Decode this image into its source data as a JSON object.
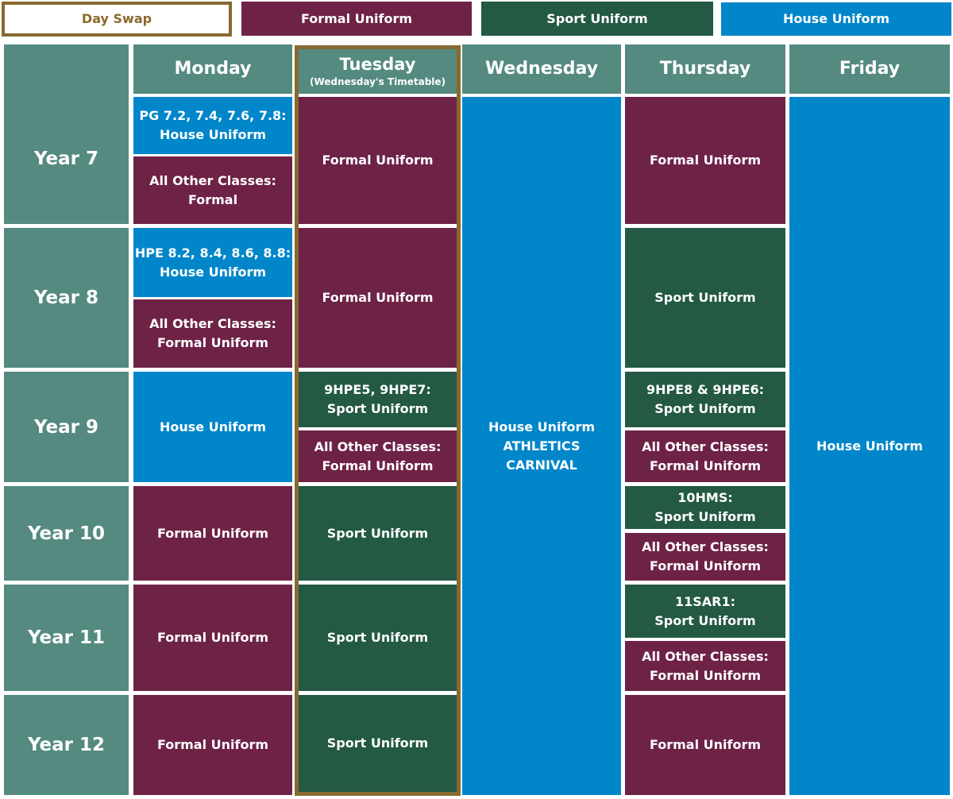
{
  "legend": {
    "day_swap": "Day Swap",
    "formal": "Formal Uniform",
    "sport": "Sport Uniform",
    "house": "House Uniform"
  },
  "colors": {
    "formal": "#6e2246",
    "sport": "#245943",
    "house": "#0186ca",
    "header": "#548a7f",
    "day_swap_border": "#866a2f"
  },
  "days": {
    "monday": "Monday",
    "tuesday": "Tuesday",
    "tuesday_note": "(Wednesday's Timetable)",
    "wednesday": "Wednesday",
    "thursday": "Thursday",
    "friday": "Friday"
  },
  "years": {
    "y7": "Year 7",
    "y8": "Year 8",
    "y9": "Year 9",
    "y10": "Year 10",
    "y11": "Year 11",
    "y12": "Year 12"
  },
  "monday": {
    "y7_a": "PG 7.2, 7.4, 7.6, 7.8:\nHouse  Uniform",
    "y7_b": "All Other Classes:\nFormal",
    "y8_a": "HPE 8.2, 8.4, 8.6, 8.8:\nHouse  Uniform",
    "y8_b": "All Other Classes:\nFormal  Uniform",
    "y9": "House Uniform",
    "y10": "Formal Uniform",
    "y11": "Formal Uniform",
    "y12": "Formal Uniform"
  },
  "tuesday": {
    "y7": "Formal Uniform",
    "y8": "Formal Uniform",
    "y9_a": "9HPE5, 9HPE7:\nSport Uniform",
    "y9_b": "All Other Classes:\nFormal Uniform",
    "y10": "Sport Uniform",
    "y11": "Sport Uniform",
    "y12": "Sport Uniform"
  },
  "wednesday": {
    "all": "House Uniform\nATHLETICS\nCARNIVAL"
  },
  "thursday": {
    "y7": "Formal Uniform",
    "y8": "Sport Uniform",
    "y9_a": "9HPE8 & 9HPE6:\nSport Uniform",
    "y9_b": "All Other Classes:\nFormal  Uniform",
    "y10_a": "10HMS:\nSport Uniform",
    "y10_b": "All Other Classes:\nFormal Uniform",
    "y11_a": "11SAR1:\nSport Uniform",
    "y11_b": "All Other Classes:\nFormal Uniform",
    "y12": "Formal Uniform"
  },
  "friday": {
    "all": "House Uniform"
  }
}
